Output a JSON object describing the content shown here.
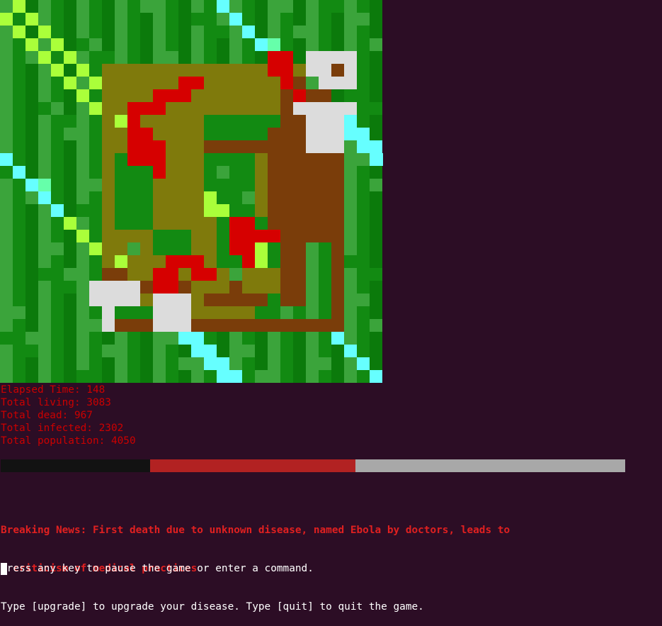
{
  "stats": {
    "elapsed": "Elapsed Time: 148",
    "living": "Total living: 3083",
    "dead": "Total dead: 967",
    "infected": "Total infected: 2302",
    "population": "Total population: 4050"
  },
  "population_bar": {
    "dead_fraction": 0.2388,
    "infected_fraction": 0.3296,
    "living_fraction": 0.4316,
    "colors": {
      "dead": "#121212",
      "infected": "#b22222",
      "living": "#a8a8a8"
    }
  },
  "news": {
    "line1": "Breaking News: First death due to unknown disease, named Ebola by doctors, leads to",
    "line2": "  criticism of medical practices"
  },
  "prompt": {
    "line1": "Press any key to pause the game or enter a command.",
    "line2": "Type [upgrade] to upgrade your disease. Type [quit] to quit the game."
  },
  "map_colors": {
    "grass_light": "#3ba43b",
    "grass_dark": "#128a12",
    "grass_mid": "#0b7a0b",
    "water": "#66ffff",
    "beach": "#aaff3a",
    "field": "#7f7a0c",
    "road": "#7a3d0a",
    "building": "#dcdcdc",
    "infected": "#d60000",
    "mint": "#66ffaa"
  }
}
